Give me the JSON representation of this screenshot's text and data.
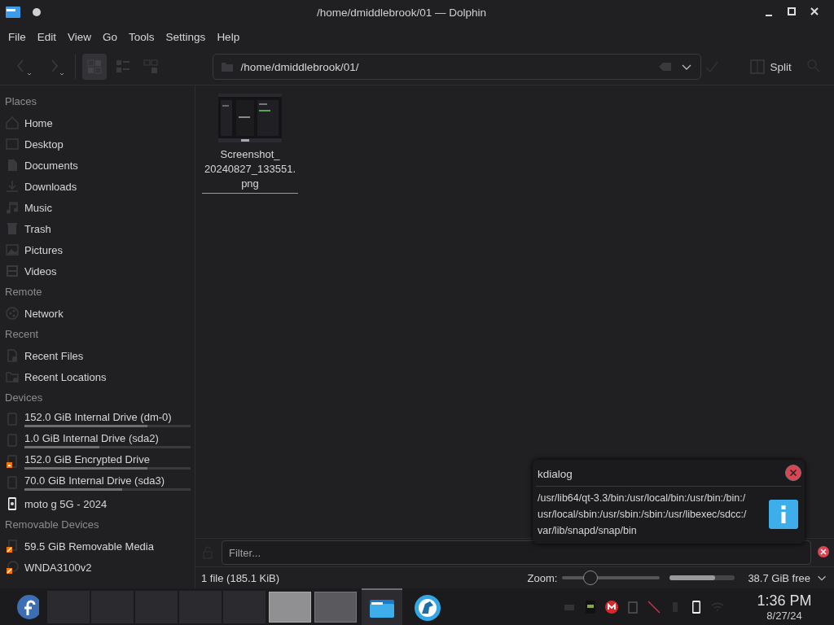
{
  "window": {
    "title": "/home/dmiddlebrook/01 — Dolphin"
  },
  "menu": [
    "File",
    "Edit",
    "View",
    "Go",
    "Tools",
    "Settings",
    "Help"
  ],
  "toolbar": {
    "view_modes": [
      {
        "selected": true
      },
      {
        "selected": false
      },
      {
        "selected": false
      }
    ],
    "location": "/home/dmiddlebrook/01/",
    "split": "Split"
  },
  "sidebar": [
    {
      "title": "Places",
      "items": [
        {
          "label": "Home"
        },
        {
          "label": "Desktop"
        },
        {
          "label": "Documents"
        },
        {
          "label": "Downloads"
        },
        {
          "label": "Music"
        },
        {
          "label": "Trash"
        },
        {
          "label": "Pictures"
        },
        {
          "label": "Videos"
        }
      ]
    },
    {
      "title": "Remote",
      "items": [
        {
          "label": "Network"
        }
      ]
    },
    {
      "title": "Recent",
      "items": [
        {
          "label": "Recent Files"
        },
        {
          "label": "Recent Locations"
        }
      ]
    },
    {
      "title": "Devices",
      "items": [
        {
          "label": "152.0 GiB Internal Drive (dm-0)",
          "level": 0.74
        },
        {
          "label": "1.0 GiB Internal Drive (sda2)",
          "level": 0.45
        },
        {
          "label": "152.0 GiB Encrypted Drive",
          "level": 0.74
        },
        {
          "label": "70.0 GiB Internal Drive (sda3)",
          "level": 0.59
        },
        {
          "label": "moto g 5G - 2024"
        }
      ]
    },
    {
      "title": "Removable Devices",
      "items": [
        {
          "label": "59.5 GiB Removable Media"
        },
        {
          "label": "WNDA3100v2"
        }
      ]
    }
  ],
  "files": [
    {
      "name": "Screenshot_20240827_133551.png",
      "kind": "picture"
    }
  ],
  "filter": {
    "placeholder": "Filter..."
  },
  "notification": {
    "app": "kdialog",
    "body": "/usr/lib64/qt-3.3/bin:/usr/local/bin:/usr/bin:/bin:/usr/local/sbin:/usr/sbin:/sbin:/usr/libexec/sdcc:/var/lib/snapd/snap/bin"
  },
  "status_bar": {
    "summary": "1 file (185.1 KiB)",
    "zoom_label": "Zoom:",
    "zoom": {
      "level": 0.29
    },
    "space": {
      "level": 0.69
    },
    "free": "38.7 GiB free"
  },
  "taskbar": {
    "pager": [
      {
        "selected": true
      },
      {
        "selected": false
      }
    ],
    "tasks": [
      {
        "selected": true
      },
      {
        "selected": false
      }
    ],
    "time": "1:36 PM",
    "date": "8/27/24"
  }
}
